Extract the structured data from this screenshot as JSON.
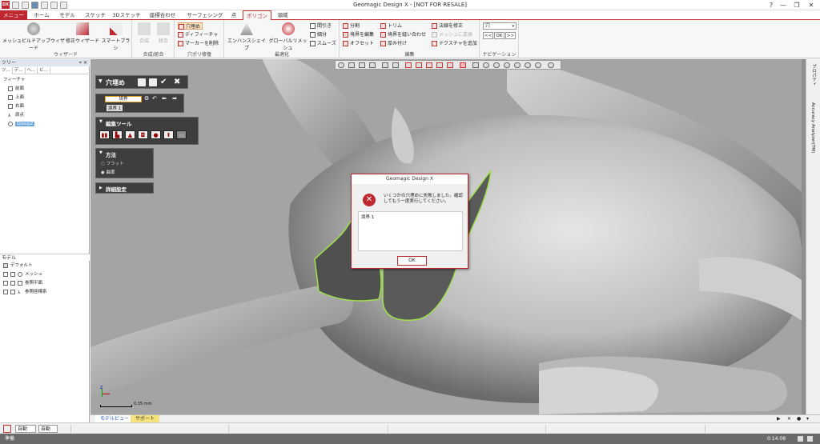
{
  "app": {
    "title": "Geomagic Design X - [NOT FOR RESALE]",
    "logo": "DX"
  },
  "window_controls": [
    "?",
    "—",
    "❐",
    "✕"
  ],
  "tabs": [
    {
      "label": "メニュー",
      "state": "menu"
    },
    {
      "label": "ホーム",
      "state": ""
    },
    {
      "label": "モデル",
      "state": ""
    },
    {
      "label": "スケッチ",
      "state": ""
    },
    {
      "label": "3Dスケッチ",
      "state": ""
    },
    {
      "label": "座標合わせ",
      "state": ""
    },
    {
      "label": "サーフェシング",
      "state": ""
    },
    {
      "label": "点",
      "state": ""
    },
    {
      "label": "ポリゴン",
      "state": "active"
    },
    {
      "label": "領域",
      "state": ""
    }
  ],
  "ribbon": {
    "wizard": {
      "label": "ウィザード",
      "buttons": [
        "メッシュビルドアップウィザード",
        "修正ウィザード",
        "スマートブラシ"
      ]
    },
    "merge": {
      "label": "合成/統合",
      "buttons": [
        "合成",
        "統合"
      ]
    },
    "hole": {
      "label": "穴ポリ修復",
      "buttons": [
        "穴埋め",
        "ディフィーチャ",
        "マーカーを削除"
      ]
    },
    "optimize": {
      "label": "最適化",
      "buttons": [
        "エンハンスシェイプ",
        "グローバルリメッシュ"
      ],
      "small": [
        "間引き",
        "細分",
        "スムーズ"
      ]
    },
    "edit": {
      "label": "編集",
      "small_col1": [
        "分割",
        "境界を編集",
        "オフセット"
      ],
      "small_col2": [
        "トリム",
        "境界を縫い合わせ",
        "厚み付け"
      ],
      "small_col3": [
        "法線を修正",
        "メッシュに変換",
        "テクスチャを追加"
      ]
    },
    "navigation": {
      "label": "ナビゲーション",
      "select_value": "穴",
      "buttons": [
        "<<",
        "OK",
        ">>"
      ]
    }
  },
  "left_pane": {
    "tree_header": "ツリー",
    "pin": "⌖ ✕",
    "tree_tabs": [
      "ツ...",
      "デ...",
      "ヘ...",
      "ビ..."
    ],
    "feature_label": "フィーチャ",
    "tree_items": [
      "前面",
      "上面",
      "右面",
      "原点",
      "Group2"
    ],
    "model_header": "モデル",
    "model_items": [
      "デフォルト",
      "メッシュ",
      "参照平面",
      "参照座標系"
    ]
  },
  "hole_fill_panel": {
    "title": "穴埋め",
    "boundary_label": "境界",
    "boundary_value": "境界 1",
    "edit_tools_label": "編集ツール",
    "method_label": "方法",
    "method_options": [
      "フラット",
      "曲率"
    ],
    "method_selected": "曲率",
    "details_label": "詳細設定"
  },
  "dialog": {
    "title": "Geomagic Design X",
    "message": "いくつかの穴埋めに失敗しました。確認してもう一度実行してください。",
    "detail": "境界 1",
    "ok_label": "OK"
  },
  "viewport": {
    "scale_label": "0.35 mm",
    "axis_labels": [
      "Z",
      "X",
      "Y"
    ]
  },
  "right_strip": {
    "tabs": [
      "プロパティ",
      "Accuracy Analyzer(TM)"
    ]
  },
  "bottom_tabs": [
    "モデルビュー",
    "サポート"
  ],
  "selection_bar": {
    "mode": "自動",
    "filter": "自動"
  },
  "status_bar": {
    "left": "準備",
    "right": "0:14.08"
  }
}
